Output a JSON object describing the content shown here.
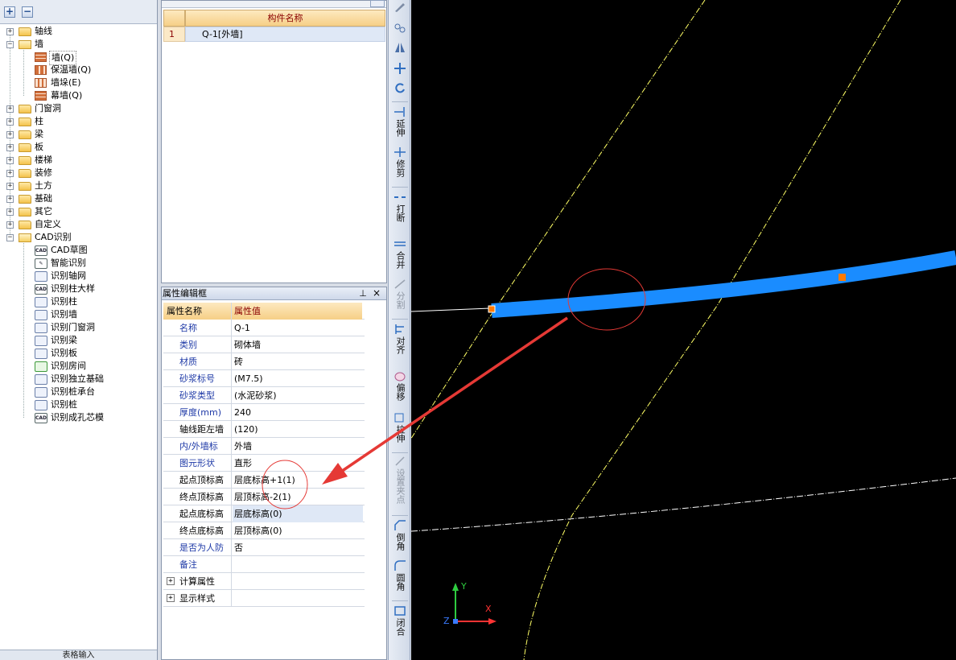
{
  "tree": {
    "toolbar": {
      "expand_label": "+",
      "collapse_label": "−"
    },
    "items": [
      {
        "label": "轴线"
      },
      {
        "label": "墙"
      },
      {
        "label": "墙(Q)"
      },
      {
        "label": "保温墙(Q)"
      },
      {
        "label": "墙垛(E)"
      },
      {
        "label": "幕墙(Q)"
      },
      {
        "label": "门窗洞"
      },
      {
        "label": "柱"
      },
      {
        "label": "梁"
      },
      {
        "label": "板"
      },
      {
        "label": "楼梯"
      },
      {
        "label": "装修"
      },
      {
        "label": "土方"
      },
      {
        "label": "基础"
      },
      {
        "label": "其它"
      },
      {
        "label": "自定义"
      },
      {
        "label": "CAD识别"
      },
      {
        "label": "CAD草图"
      },
      {
        "label": "智能识别"
      },
      {
        "label": "识别轴网"
      },
      {
        "label": "识别柱大样"
      },
      {
        "label": "识别柱"
      },
      {
        "label": "识别墙"
      },
      {
        "label": "识别门窗洞"
      },
      {
        "label": "识别梁"
      },
      {
        "label": "识别板"
      },
      {
        "label": "识别房间"
      },
      {
        "label": "识别独立基础"
      },
      {
        "label": "识别桩承台"
      },
      {
        "label": "识别桩"
      },
      {
        "label": "识别成孔芯模"
      }
    ],
    "bottom_label": "表格输入"
  },
  "component_list": {
    "header_name": "构件名称",
    "rows": [
      {
        "num": "1",
        "name": "Q-1[外墙]"
      }
    ]
  },
  "properties": {
    "title": "属性编辑框",
    "pin_icon": "ꟷ",
    "close_icon": "×",
    "header_key": "属性名称",
    "header_value": "属性值",
    "rows": [
      {
        "key": "名称",
        "value": "Q-1"
      },
      {
        "key": "类别",
        "value": "砌体墙"
      },
      {
        "key": "材质",
        "value": "砖"
      },
      {
        "key": "砂浆标号",
        "value": "(M7.5)"
      },
      {
        "key": "砂浆类型",
        "value": "(水泥砂浆)"
      },
      {
        "key": "厚度(mm)",
        "value": "240"
      },
      {
        "key": "轴线距左墙",
        "value": "(120)"
      },
      {
        "key": "内/外墙标",
        "value": "外墙"
      },
      {
        "key": "图元形状",
        "value": "直形"
      },
      {
        "key": "起点顶标高",
        "value": "层底标高+1(1)"
      },
      {
        "key": "终点顶标高",
        "value": "层顶标高-2(1)"
      },
      {
        "key": "起点底标高",
        "value": "层底标高(0)"
      },
      {
        "key": "终点底标高",
        "value": "层顶标高(0)"
      },
      {
        "key": "是否为人防",
        "value": "否"
      },
      {
        "key": "备注",
        "value": ""
      },
      {
        "key": "计算属性",
        "value": ""
      },
      {
        "key": "显示样式",
        "value": ""
      }
    ]
  },
  "vertical_toolbar": {
    "extend": "延伸",
    "trim": "修剪",
    "break": "打断",
    "merge": "合并",
    "split": "分割",
    "align": "对齐",
    "offset": "偏移",
    "stretch": "拉伸",
    "set_grip": "设置夹点",
    "chamfer": "倒角",
    "fillet": "圆角",
    "close": "闭合"
  },
  "canvas": {
    "axis_x": "X",
    "axis_y": "Y",
    "axis_z": "Z",
    "wall_color": "#1a8cff",
    "guide_color": "#ffff66",
    "grip_color": "#ff7a00",
    "annotation_color": "#e53935"
  }
}
